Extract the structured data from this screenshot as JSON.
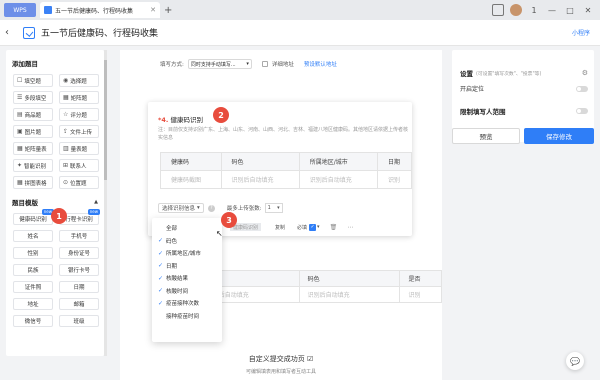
{
  "titlebar": {
    "wps_label": "WPS",
    "tab_label": "五一节后健康码、行程码收集",
    "tab_close": "✕",
    "new_tab": "+",
    "ctrl_restore": "1",
    "ctrl_min": "—",
    "ctrl_max": "□",
    "ctrl_close": "✕"
  },
  "header": {
    "back": "‹",
    "title": "五一节后健康码、行程码收集",
    "mini_program": "小程序"
  },
  "left": {
    "add_title": "添加题目",
    "question_types": [
      {
        "icon": "☐",
        "label": "填空题"
      },
      {
        "icon": "◉",
        "label": "选择题"
      },
      {
        "icon": "☰",
        "label": "多段填空"
      },
      {
        "icon": "▦",
        "label": "矩阵题"
      },
      {
        "icon": "▤",
        "label": "商品题"
      },
      {
        "icon": "☆",
        "label": "评分题"
      },
      {
        "icon": "▣",
        "label": "图片题"
      },
      {
        "icon": "⇪",
        "label": "文件上传"
      },
      {
        "icon": "▦",
        "label": "矩阵量表"
      },
      {
        "icon": "▥",
        "label": "量表题"
      },
      {
        "icon": "✦",
        "label": "智能识别"
      },
      {
        "icon": "⊞",
        "label": "联系人"
      },
      {
        "icon": "▦",
        "label": "拼图表格"
      },
      {
        "icon": "⊙",
        "label": "位置题"
      }
    ],
    "template_title": "题目模版",
    "collapse_arrow": "▲",
    "templates": [
      {
        "label": "健康码识别",
        "tag": "new"
      },
      {
        "label": "行程卡识别",
        "tag": "new"
      },
      {
        "label": "姓名",
        "tag": ""
      },
      {
        "label": "手机号",
        "tag": ""
      },
      {
        "label": "性别",
        "tag": ""
      },
      {
        "label": "身份证号",
        "tag": ""
      },
      {
        "label": "民族",
        "tag": ""
      },
      {
        "label": "银行卡号",
        "tag": ""
      },
      {
        "label": "证件照",
        "tag": ""
      },
      {
        "label": "日期",
        "tag": ""
      },
      {
        "label": "地址",
        "tag": ""
      },
      {
        "label": "邮箱",
        "tag": ""
      },
      {
        "label": "微信号",
        "tag": ""
      },
      {
        "label": "班级",
        "tag": ""
      }
    ]
  },
  "badges": {
    "one": "1",
    "two": "2",
    "three": "3"
  },
  "topbar": {
    "mode_label": "填写方式:",
    "mode_value": "同时支持手动填写...",
    "mode_arrow": "▾",
    "detail_label": "详细地址",
    "default_link": "预设默认地址"
  },
  "question": {
    "number": "*4.",
    "title": "健康码识别",
    "desc": "注：目前仅支持识别广东、上海、山东、河南、山西、河北、吉林、福建八地区健康码。其他地区请依据上传者核实信息",
    "headers": [
      "健康码",
      "码色",
      "所属地区/城市",
      "日期"
    ],
    "row": [
      "健康码截图",
      "识别后自动填充",
      "识别后自动填充",
      "识别"
    ],
    "select_label": "选择识别信息",
    "select_arrow": "▾",
    "help": "?",
    "max_label": "最多上传张数:",
    "max_value": "1",
    "max_arrow": "▾",
    "foot_tag": "健康码识别",
    "copy": "复制",
    "required": "必填",
    "check": "✓",
    "more": "▾",
    "delete": "🗑",
    "dots": "⋯"
  },
  "menu": {
    "items": [
      {
        "checked": false,
        "label": "全部"
      },
      {
        "checked": true,
        "label": "码色"
      },
      {
        "checked": true,
        "label": "所属地区/城市"
      },
      {
        "checked": true,
        "label": "日期"
      },
      {
        "checked": true,
        "label": "核酸结果"
      },
      {
        "checked": true,
        "label": "核酸时间"
      },
      {
        "checked": true,
        "label": "疫苗接种次数"
      },
      {
        "checked": false,
        "label": "接种疫苗时间"
      }
    ]
  },
  "q2": {
    "headers": [
      "",
      "日期",
      "码色",
      "是否"
    ],
    "row": [
      "",
      "识别后自动填充",
      "识别后自动填充",
      "识别"
    ]
  },
  "custom": {
    "title": "自定义提交成功页 ☑",
    "sub": "可编辑填表用和填写者互动工具"
  },
  "right": {
    "settings_title": "设置",
    "settings_hint": "(可设置\"填写次数\"、\"投票\"等)",
    "gear": "⚙",
    "location_label": "开启定位",
    "limit_title": "限制填写人范围",
    "preview": "预览",
    "save": "保存修改"
  },
  "chat_icon": "💬",
  "cursor": "↖"
}
